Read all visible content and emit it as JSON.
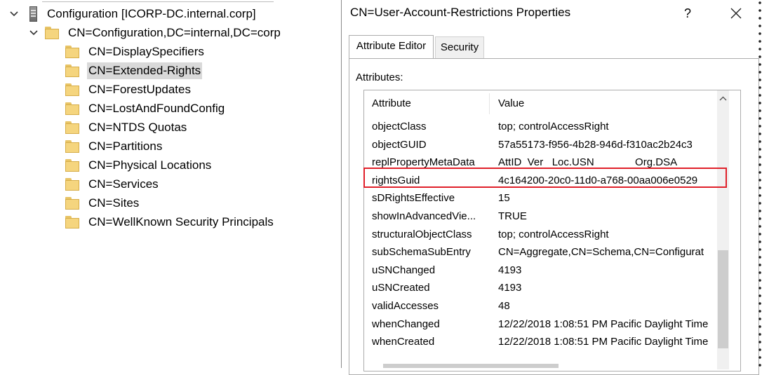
{
  "tree": {
    "root": "Configuration [ICORP-DC.internal.corp]",
    "container": "CN=Configuration,DC=internal,DC=corp",
    "children": [
      "CN=DisplaySpecifiers",
      "CN=Extended-Rights",
      "CN=ForestUpdates",
      "CN=LostAndFoundConfig",
      "CN=NTDS Quotas",
      "CN=Partitions",
      "CN=Physical Locations",
      "CN=Services",
      "CN=Sites",
      "CN=WellKnown Security Principals"
    ],
    "selected": "CN=Extended-Rights"
  },
  "dialog": {
    "title": "CN=User-Account-Restrictions Properties",
    "help": "?",
    "tabs": [
      "Attribute Editor",
      "Security"
    ],
    "active_tab": "Attribute Editor",
    "attributes_label": "Attributes:",
    "columns": [
      "Attribute",
      "Value"
    ],
    "rows": [
      {
        "attr": "objectClass",
        "value": "top; controlAccessRight"
      },
      {
        "attr": "objectGUID",
        "value": "57a55173-f956-4b28-946d-f310ac2b24c3"
      },
      {
        "attr": "replPropertyMetaData",
        "value": "AttID  Ver   Loc.USN              Org.DSA"
      },
      {
        "attr": "rightsGuid",
        "value": "4c164200-20c0-11d0-a768-00aa006e0529"
      },
      {
        "attr": "sDRightsEffective",
        "value": "15"
      },
      {
        "attr": "showInAdvancedVie...",
        "value": "TRUE"
      },
      {
        "attr": "structuralObjectClass",
        "value": "top; controlAccessRight"
      },
      {
        "attr": "subSchemaSubEntry",
        "value": "CN=Aggregate,CN=Schema,CN=Configurat"
      },
      {
        "attr": "uSNChanged",
        "value": "4193"
      },
      {
        "attr": "uSNCreated",
        "value": "4193"
      },
      {
        "attr": "validAccesses",
        "value": "48"
      },
      {
        "attr": "whenChanged",
        "value": "12/22/2018 1:08:51 PM Pacific Daylight Time"
      },
      {
        "attr": "whenCreated",
        "value": "12/22/2018 1:08:51 PM Pacific Daylight Time"
      }
    ],
    "highlighted_attr": "rightsGuid",
    "highlight_color": "#e0202a"
  }
}
